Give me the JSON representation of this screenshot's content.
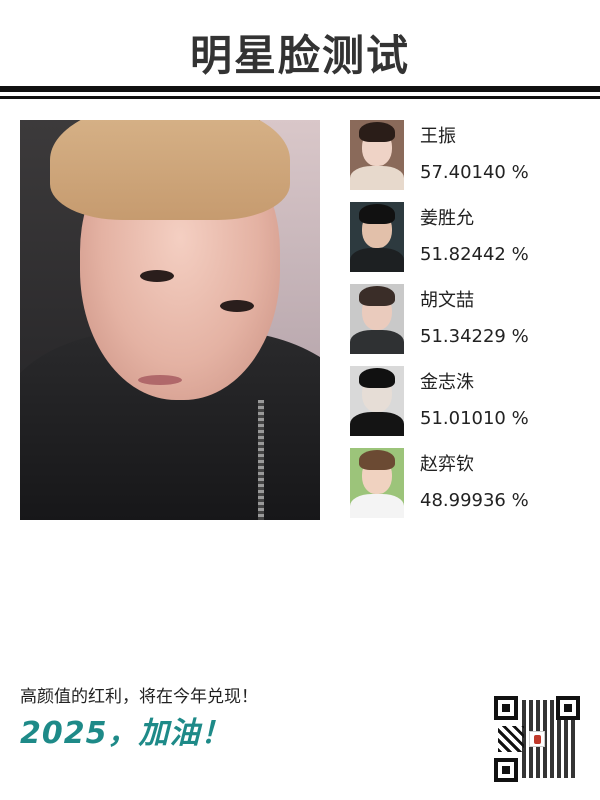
{
  "header": {
    "title": "明星脸测试"
  },
  "photo": {
    "alt": "user-selfie"
  },
  "matches": [
    {
      "name": "王振",
      "score": "57.40140 %",
      "thumb": {
        "bg": "#8a6a5a",
        "hair": "#2a1d18",
        "skin": "#efd3c6",
        "body": "#e7d9cc"
      }
    },
    {
      "name": "姜胜允",
      "score": "51.82442 %",
      "thumb": {
        "bg": "#2d3a3f",
        "hair": "#111111",
        "skin": "#e2c0aa",
        "body": "#1d2022"
      }
    },
    {
      "name": "胡文喆",
      "score": "51.34229 %",
      "thumb": {
        "bg": "#c9c9c9",
        "hair": "#3a2d28",
        "skin": "#eacbbd",
        "body": "#2f3133"
      }
    },
    {
      "name": "金志洙",
      "score": "51.01010 %",
      "thumb": {
        "bg": "#d9d9d9",
        "hair": "#111111",
        "skin": "#e6ddd6",
        "body": "#141414"
      }
    },
    {
      "name": "赵弈钦",
      "score": "48.99936 %",
      "thumb": {
        "bg": "#9cc47a",
        "hair": "#6b4a33",
        "skin": "#f0d2c0",
        "body": "#f4f4f4"
      }
    }
  ],
  "footer": {
    "slogan": "高颜值的红利，将在今年兑现！",
    "cheer": "2025，加油！"
  },
  "colors": {
    "accent": "#1e8a88",
    "rule": "#111111"
  },
  "icons": {
    "qr": "qr-code-icon"
  }
}
